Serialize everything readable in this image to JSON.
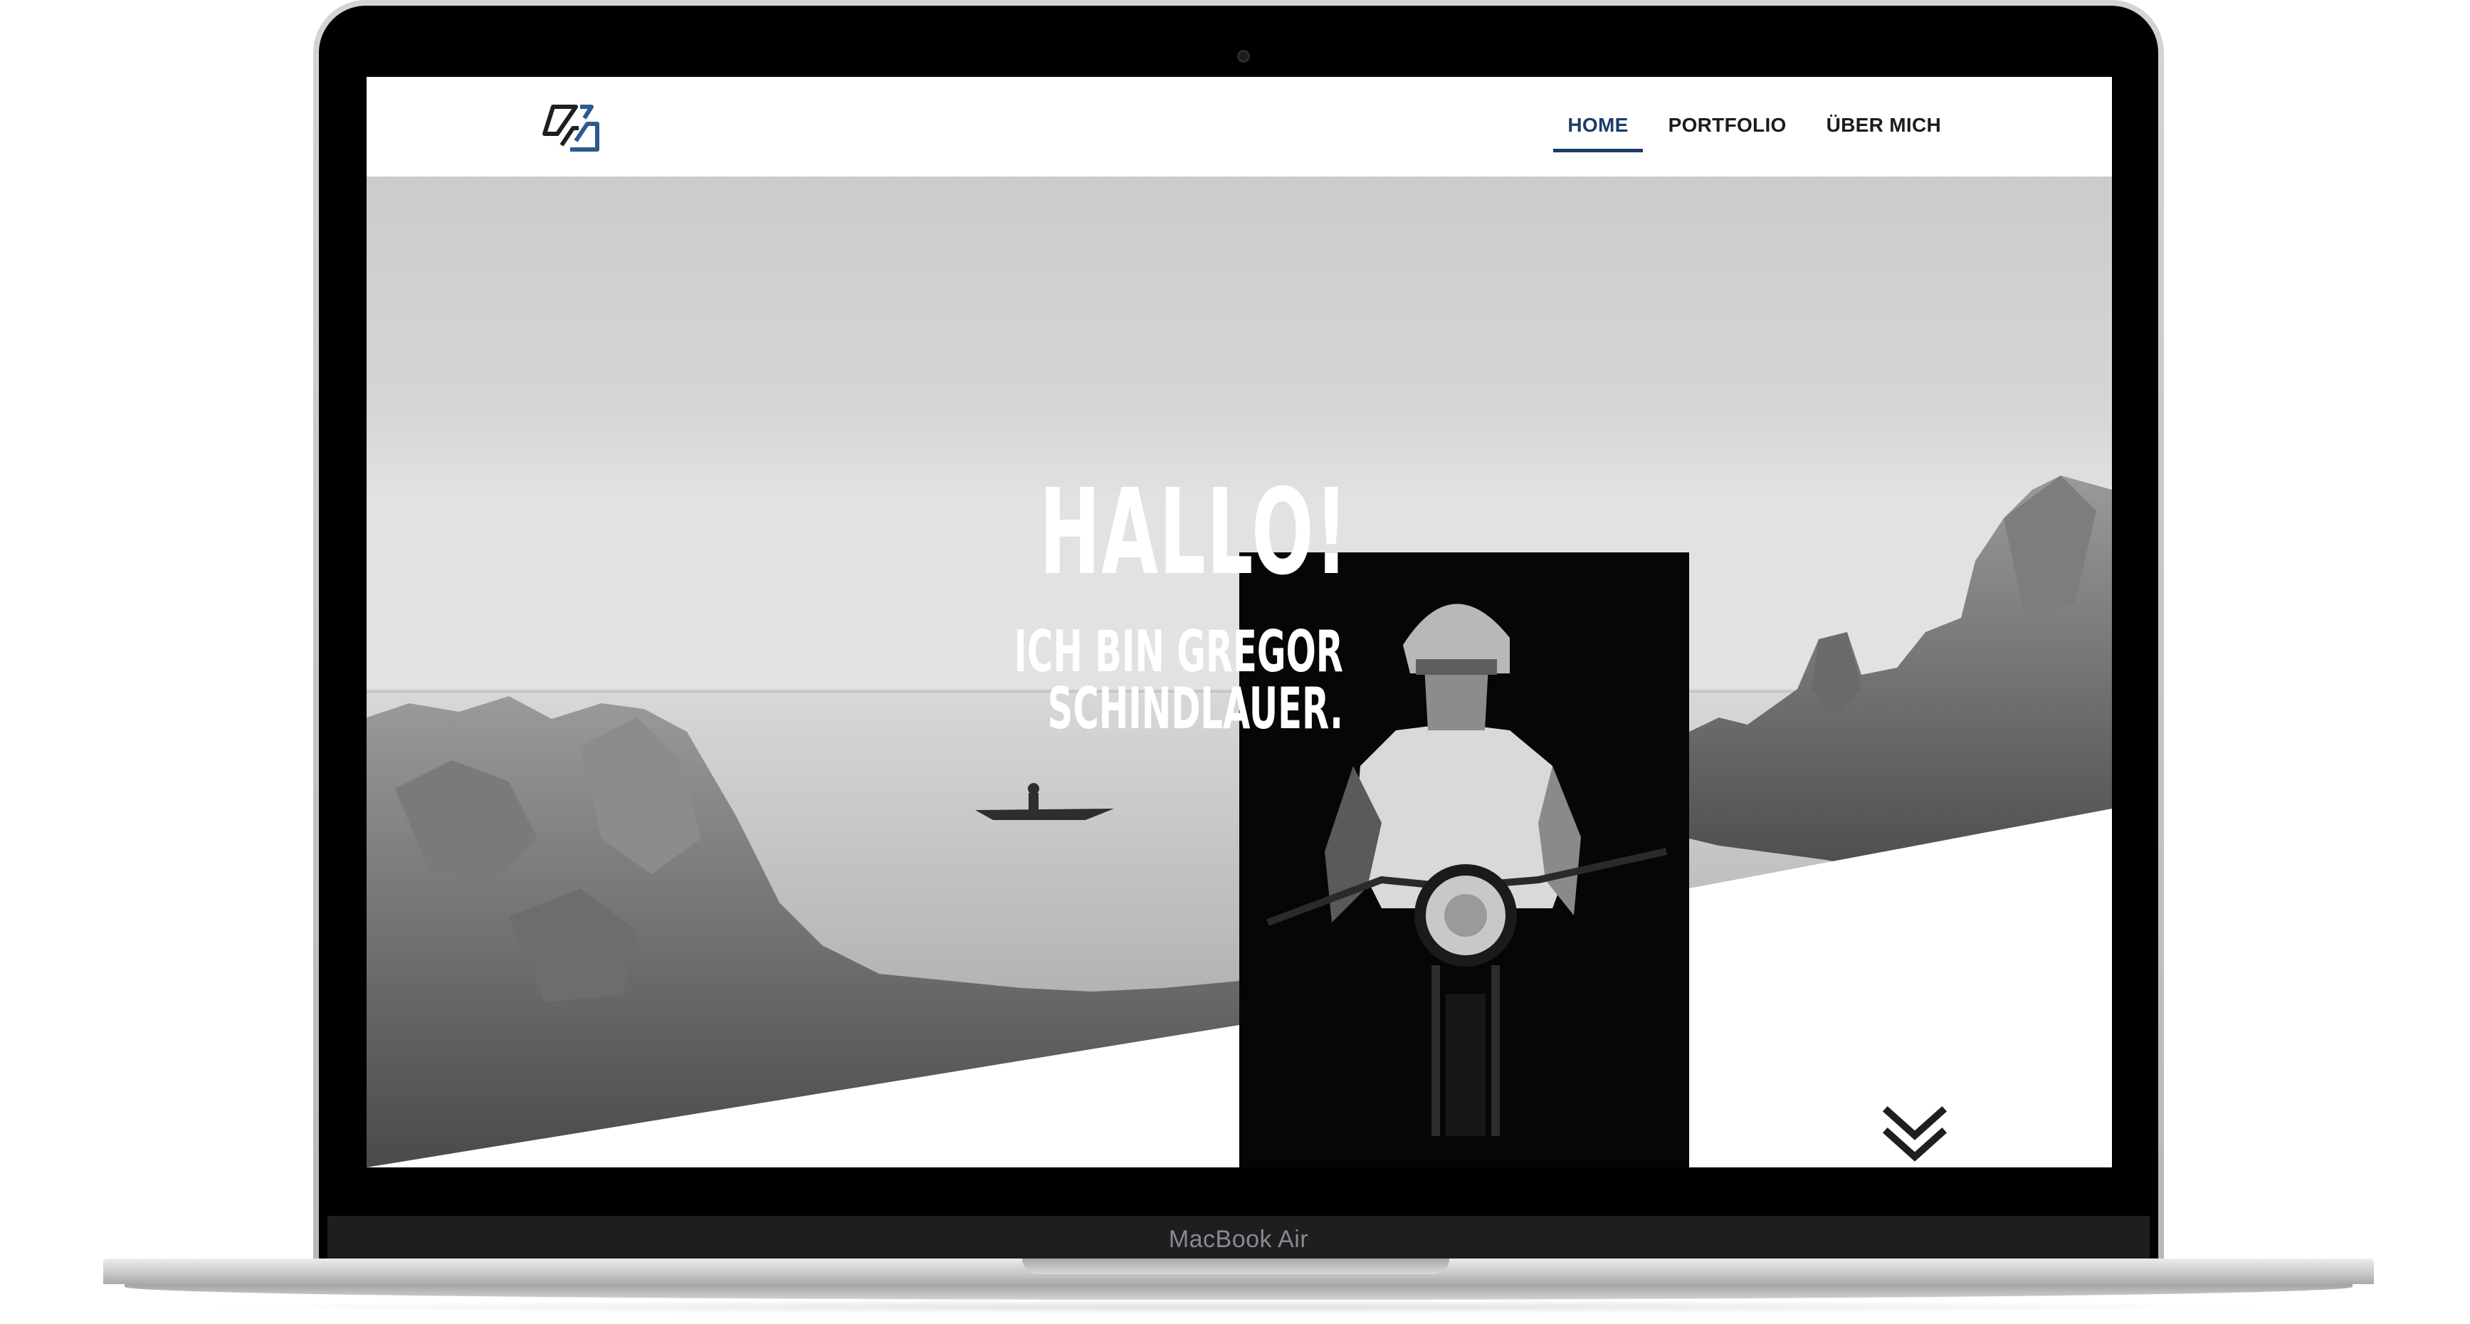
{
  "device": {
    "label": "MacBook Air"
  },
  "site": {
    "logo_name": "logo-monogram-icon",
    "nav": [
      {
        "label": "HOME",
        "active": true
      },
      {
        "label": "PORTFOLIO",
        "active": false
      },
      {
        "label": "ÜBER MICH",
        "active": false
      }
    ],
    "accent_color": "#1d3d66"
  },
  "hero": {
    "title": "HALLO!",
    "subtitle": "ICH BIN GREGOR SCHINDLAUER.",
    "scroll_icon": "double-chevron-down-icon"
  }
}
